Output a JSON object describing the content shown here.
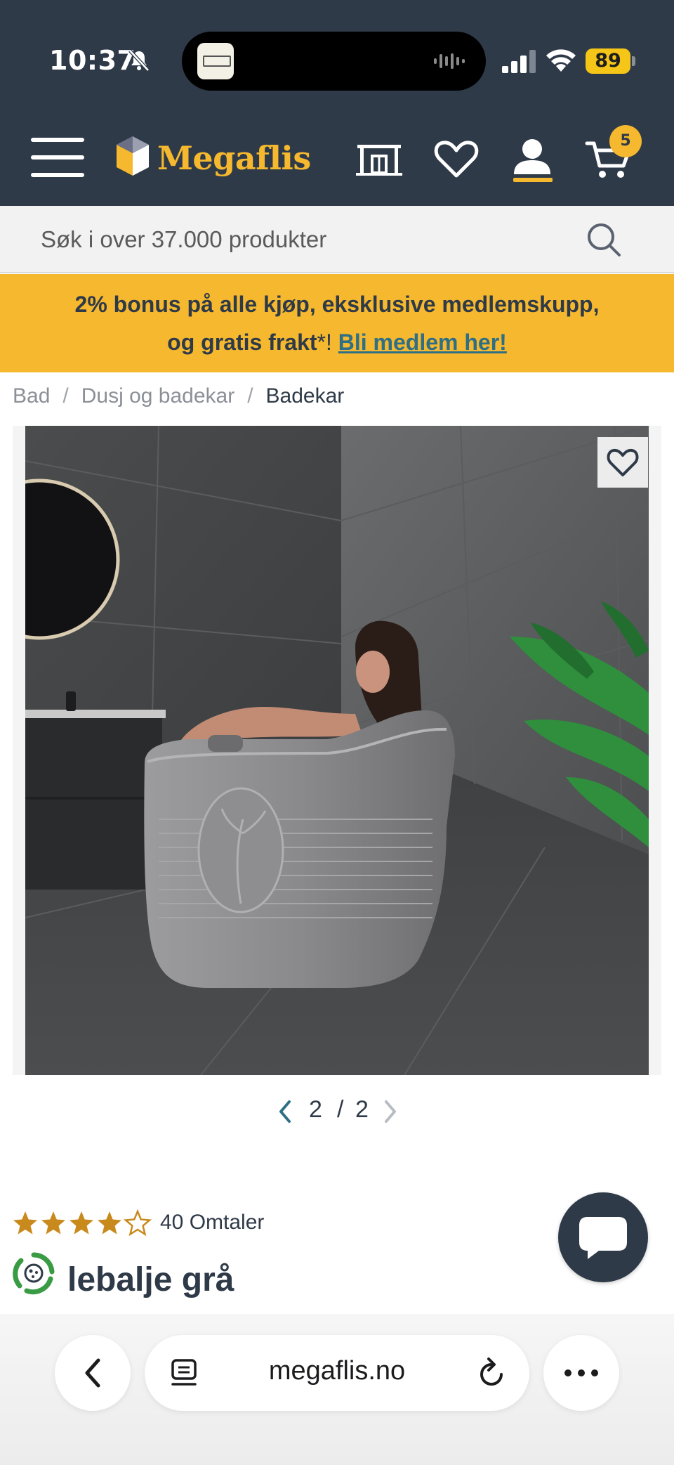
{
  "status_bar": {
    "time": "10:37",
    "battery": "89",
    "mute_icon": "bell-slash-icon",
    "signal_icon": "cellular-signal-icon",
    "wifi_icon": "wifi-icon"
  },
  "header": {
    "logo_text": "Megaflis",
    "menu_icon": "hamburger-menu-icon",
    "icons": [
      "store-icon",
      "heart-icon",
      "user-icon",
      "cart-icon"
    ],
    "cart_count": "5",
    "colors": {
      "background": "#2f3a48",
      "accent": "#f5b82e"
    }
  },
  "search": {
    "placeholder": "Søk i over 37.000 produkter",
    "icon": "search-icon"
  },
  "promo": {
    "text_line1": "2% bonus på alle kjøp, eksklusive medlemskupp,",
    "text_line2": "og gratis frakt",
    "asterisk": "*!",
    "link": "Bli medlem her!",
    "colors": {
      "background": "#f5b82e",
      "link": "#2f6f85"
    }
  },
  "breadcrumb": {
    "items": [
      "Bad",
      "Dusj og badekar",
      "Badekar"
    ],
    "separator": "/"
  },
  "gallery": {
    "current": "2",
    "slash": "/",
    "total": "2",
    "favorite_icon": "heart-icon"
  },
  "product": {
    "rating": 4.5,
    "rating_max": 5,
    "review_count_label": "40 Omtaler",
    "title_visible": "lebalje grå",
    "badge_icon": "eco-recycle-icon"
  },
  "chat": {
    "icon": "chat-bubble-icon"
  },
  "browser": {
    "url": "megaflis.no",
    "icons": [
      "back-chevron-icon",
      "tabs-icon",
      "reload-icon",
      "more-dots-icon"
    ]
  }
}
